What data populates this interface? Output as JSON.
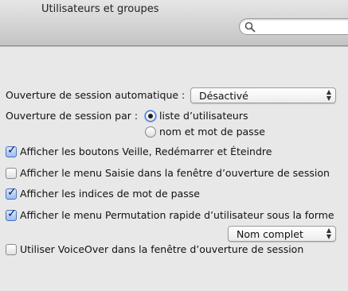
{
  "window": {
    "title": "Utilisateurs et groupes"
  },
  "search": {
    "placeholder": ""
  },
  "login_options": {
    "auto_login_label": "Ouverture de session automatique :",
    "auto_login_value": "Désactivé",
    "login_by_label": "Ouverture de session par :",
    "radio_list_users": "liste d’utilisateurs",
    "radio_name_password": "nom et mot de passe",
    "selected_radio": "liste d’utilisateurs",
    "checkboxes": [
      {
        "label": "Afficher les boutons Veille, Redémarrer et Éteindre",
        "checked": true
      },
      {
        "label": "Afficher le menu Saisie dans la fenêtre d’ouverture de session",
        "checked": false
      },
      {
        "label": "Afficher les indices de mot de passe",
        "checked": true
      },
      {
        "label": "Afficher le menu Permutation rapide d’utilisateur sous la forme",
        "checked": true
      },
      {
        "label": "Utiliser VoiceOver dans la fenêtre d’ouverture de session",
        "checked": false
      }
    ],
    "fast_switch_value": "Nom complet"
  }
}
